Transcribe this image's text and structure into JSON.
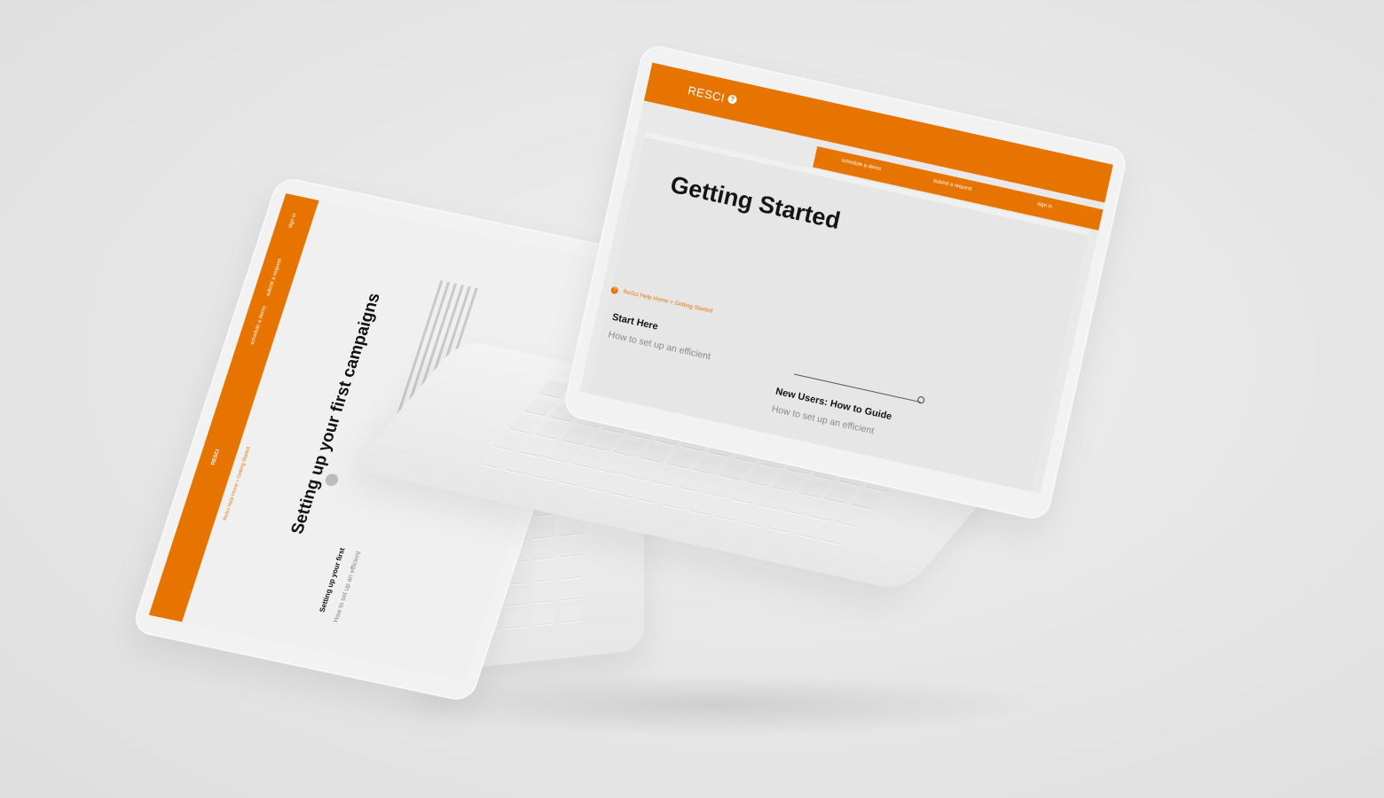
{
  "right_screen": {
    "logo": "RESCI",
    "help_icon": "?",
    "nav": [
      "schedule a demo",
      "submit a request",
      "sign in"
    ],
    "title": "Getting Started",
    "breadcrumb": "ReSci Help Home > Getting Started",
    "start_here_title": "Start Here",
    "start_here_link": "How to set up an efficient",
    "new_users_title": "New Users: How to Guide",
    "new_users_link": "How to set up an efficient"
  },
  "left_screen": {
    "logo": "RESCI",
    "nav": [
      "schedule a demo",
      "submit a request",
      "sign in"
    ],
    "breadcrumb": "ReSci Help Home > Getting Started",
    "title": "Setting up your first campaigns",
    "sub_title": "Setting up your first",
    "sub_link": "How to set up an efficient"
  },
  "colors": {
    "brand_orange": "#e87400",
    "background": "#e6e6e6",
    "device": "#f2f2f2"
  }
}
